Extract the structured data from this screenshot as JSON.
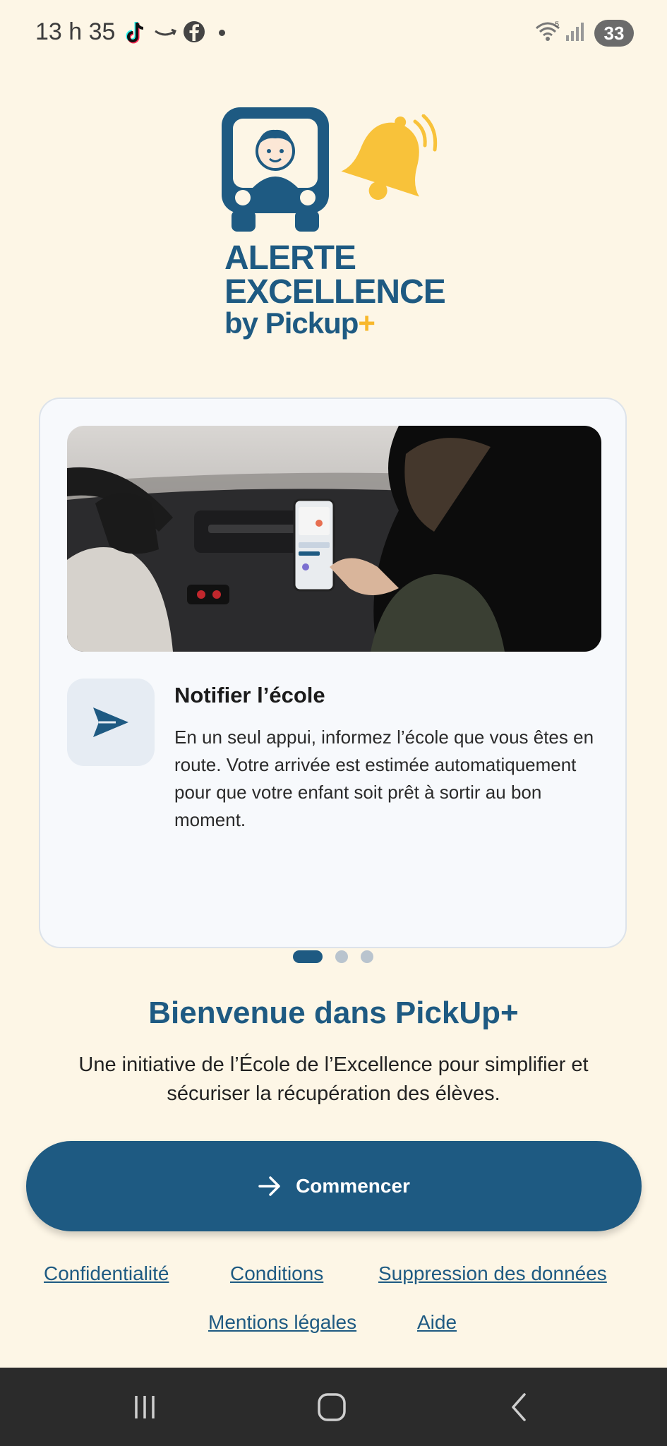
{
  "status_bar": {
    "time": "13 h 35",
    "battery": "33",
    "icons": [
      "tiktok-icon",
      "amazon-icon",
      "facebook-icon",
      "dot-icon",
      "wifi-icon",
      "signal-icon"
    ]
  },
  "logo": {
    "line1": "ALERTE",
    "line2": "EXCELLENCE",
    "by": "by Pickup",
    "plus": "+",
    "icons": [
      "bus-driver-icon",
      "bell-icon"
    ]
  },
  "feature": {
    "title": "Notifier l’école",
    "description": "En un seul appui, informez l’école que vous êtes en route. Votre arrivée est estimée automatiquement pour que votre enfant soit prêt à sortir au bon moment.",
    "icon": "send-icon"
  },
  "pager": {
    "total": 3,
    "active": 1
  },
  "welcome": {
    "title": "Bienvenue dans PickUp+",
    "subtitle": "Une initiative de l’École de l’Excellence pour simplifier et sécuriser la récupération des élèves."
  },
  "start_button": {
    "label": "Commencer",
    "icon": "arrow-right-icon"
  },
  "links": {
    "privacy": "Confidentialité",
    "terms": "Conditions",
    "delete": "Suppression des données",
    "legal": "Mentions légales",
    "help": "Aide"
  },
  "nav": {
    "icons": [
      "recent-apps-icon",
      "home-icon",
      "back-icon"
    ]
  },
  "colors": {
    "background": "#FDF6E6",
    "primary": "#1E5A82",
    "accent": "#F8B82B"
  }
}
